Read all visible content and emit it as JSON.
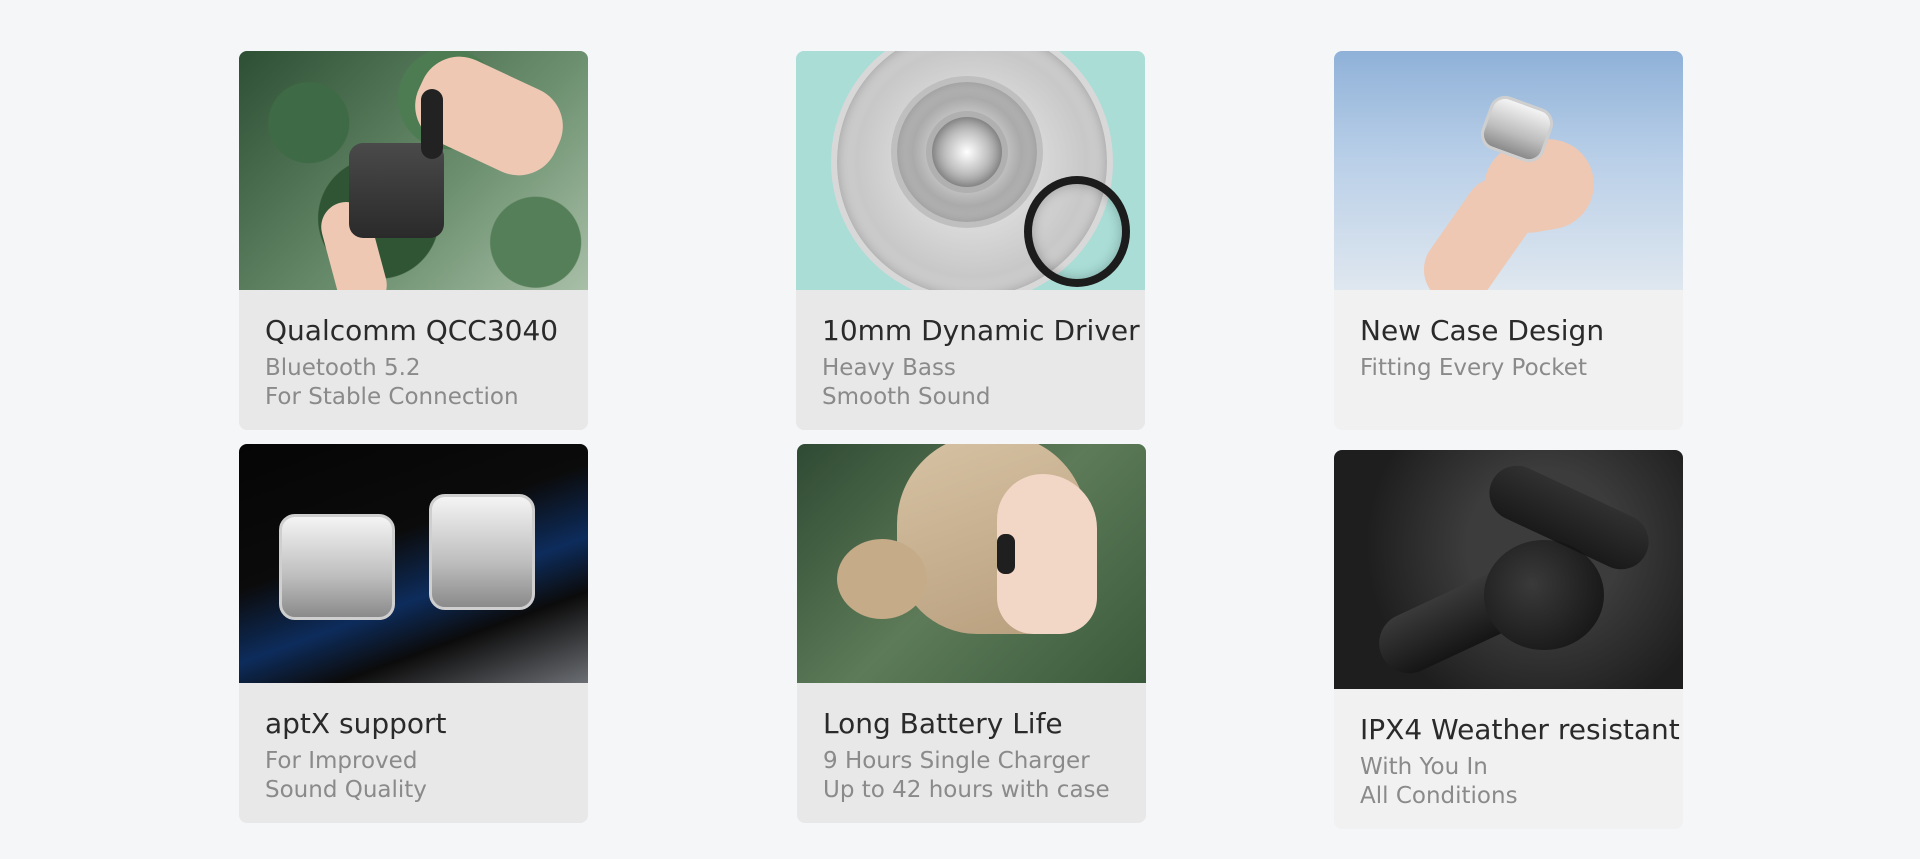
{
  "features": [
    {
      "title": "Qualcomm QCC3040",
      "lines": [
        "Bluetooth 5.2",
        "For Stable Connection"
      ],
      "image_icon": "earbuds-case-hands-image"
    },
    {
      "title": "10mm Dynamic Driver",
      "lines": [
        "Heavy Bass",
        "Smooth Sound"
      ],
      "image_icon": "driver-exploded-image"
    },
    {
      "title": "New Case Design",
      "lines": [
        "Fitting Every Pocket",
        ""
      ],
      "image_icon": "case-in-hand-sky-image"
    },
    {
      "title": "aptX support",
      "lines": [
        "For Improved",
        "Sound Quality"
      ],
      "image_icon": "silver-cases-image"
    },
    {
      "title": "Long Battery Life",
      "lines": [
        "9 Hours Single Charger",
        "Up to 42 hours with case"
      ],
      "image_icon": "woman-wearing-earbud-image"
    },
    {
      "title": "IPX4 Weather resistant",
      "lines": [
        "With You In",
        "All Conditions"
      ],
      "image_icon": "wet-earbuds-image"
    }
  ]
}
